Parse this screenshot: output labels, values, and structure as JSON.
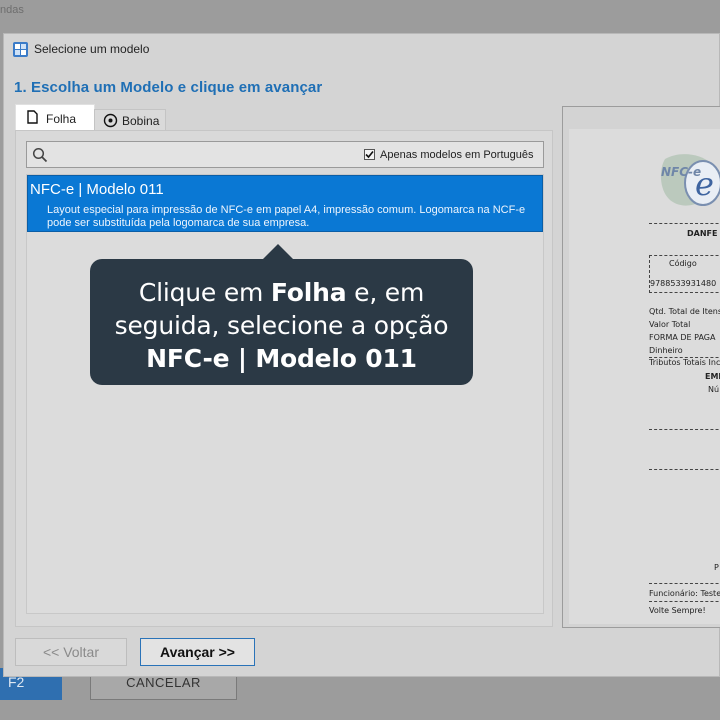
{
  "background": {
    "menu_text": "ndas",
    "f2_label": "F2",
    "cancel_label": "CANCELAR"
  },
  "dialog": {
    "title": "Selecione um modelo",
    "step_title": "1. Escolha um Modelo e clique em avançar",
    "tabs": [
      {
        "label": "Folha",
        "icon": "page-icon",
        "selected": true
      },
      {
        "label": "Bobina",
        "icon": "roll-icon",
        "selected": false
      }
    ],
    "search": {
      "value": "",
      "placeholder": ""
    },
    "filter_checkbox": {
      "label": "Apenas modelos em Português",
      "checked": true
    },
    "models": [
      {
        "title": "NFC-e | Modelo 011",
        "description": "Layout especial para impressão de NFC-e em papel A4, impressão comum. Logomarca na NCF-e pode ser substituída pela logomarca de sua empresa.",
        "selected": true
      }
    ],
    "preview": {
      "logo_text": "NFC-e",
      "header": "DANFE N",
      "col_code": "Código",
      "code_value": "9788533931480",
      "qty_line": "Qtd. Total de Itens",
      "total_line": "Valor Total",
      "payment_line": "FORMA DE PAGA",
      "cash_line": "Dinheiro",
      "taxes_line": "Tributos Totais Inc",
      "emit_line": "EMI",
      "number_line": "Nú",
      "p_line": "P",
      "employee_line": "Funcionário: Teste",
      "thanks_line": "Volte Sempre!"
    },
    "buttons": {
      "back": "<< Voltar",
      "next": "Avançar >>"
    }
  },
  "callout": {
    "line1_pre": "Clique em ",
    "line1_bold": "Folha",
    "line1_post": " e, em",
    "line2": "seguida, selecione a opção",
    "line3_bold": "NFC-e | Modelo 011"
  },
  "colors": {
    "accent": "#1f6fb5",
    "selection": "#0a78d4",
    "callout_bg": "#2b3945"
  }
}
